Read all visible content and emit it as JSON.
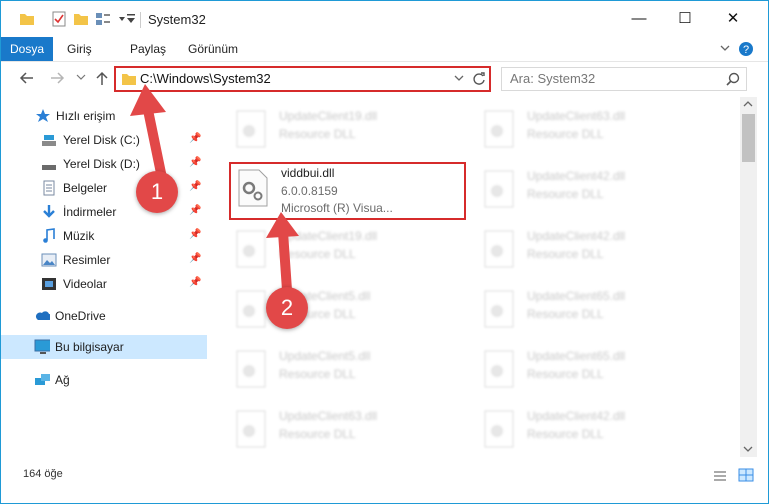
{
  "window": {
    "title": "System32",
    "minimize": "—",
    "maximize": "☐",
    "close": "✕"
  },
  "ribbon": {
    "tabs": [
      "Dosya",
      "Giriş",
      "Paylaş",
      "Görünüm"
    ]
  },
  "address": {
    "path": "C:\\Windows\\System32",
    "search_placeholder": "Ara: System32"
  },
  "nav": {
    "items": [
      {
        "label": "Hızlı erişim",
        "icon": "star-icon",
        "pinned": false
      },
      {
        "label": "Yerel Disk (C:)",
        "icon": "drive-icon",
        "pinned": true
      },
      {
        "label": "Yerel Disk (D:)",
        "icon": "drive-icon",
        "pinned": true
      },
      {
        "label": "Belgeler",
        "icon": "documents-icon",
        "pinned": true
      },
      {
        "label": "İndirmeler",
        "icon": "download-icon",
        "pinned": true
      },
      {
        "label": "Müzik",
        "icon": "music-icon",
        "pinned": true
      },
      {
        "label": "Resimler",
        "icon": "pictures-icon",
        "pinned": true
      },
      {
        "label": "Videolar",
        "icon": "video-icon",
        "pinned": true
      },
      {
        "label": "OneDrive",
        "icon": "cloud-icon",
        "pinned": false
      },
      {
        "label": "Bu bilgisayar",
        "icon": "computer-icon",
        "pinned": false
      },
      {
        "label": "Ağ",
        "icon": "network-icon",
        "pinned": false
      }
    ]
  },
  "files": {
    "highlighted": {
      "name": "viddbui.dll",
      "version": "6.0.0.8159",
      "company": "Microsoft (R) Visua..."
    },
    "left_column": [
      {
        "name": "UpdateClient19.dll",
        "desc": "Resource DLL"
      },
      {
        "name": "UpdateClient19.dll",
        "desc": "Resource DLL"
      },
      {
        "name": "UpdateClient5.dll",
        "desc": "Resource DLL"
      },
      {
        "name": "UpdateClient5.dll",
        "desc": "Resource DLL"
      },
      {
        "name": "UpdateClient63.dll",
        "desc": "Resource DLL"
      }
    ],
    "right_column": [
      {
        "name": "UpdateClient63.dll",
        "desc": "Resource DLL"
      },
      {
        "name": "UpdateClient42.dll",
        "desc": "Resource DLL"
      },
      {
        "name": "UpdateClient42.dll",
        "desc": "Resource DLL"
      },
      {
        "name": "UpdateClient65.dll",
        "desc": "Resource DLL"
      },
      {
        "name": "UpdateClient65.dll",
        "desc": "Resource DLL"
      },
      {
        "name": "UpdateClient42.dll",
        "desc": "Resource DLL"
      }
    ]
  },
  "status": {
    "item_count": "164 öğe"
  },
  "annotations": {
    "step1": "1",
    "step2": "2",
    "color": "#e24848"
  }
}
